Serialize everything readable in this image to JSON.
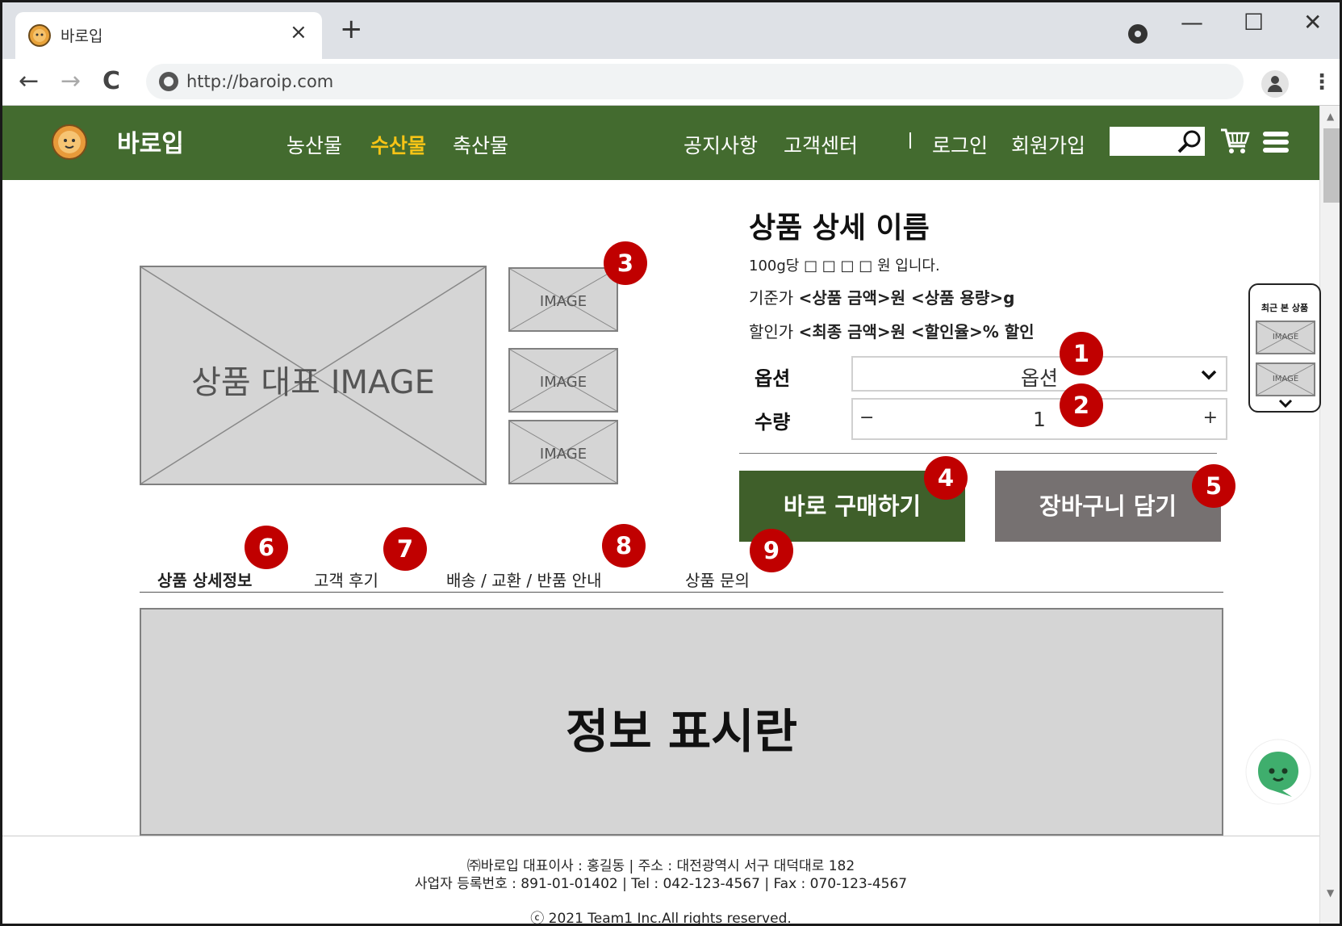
{
  "browser": {
    "tab_title": "바로입",
    "tab_close": "×",
    "new_tab": "+",
    "minimize": "—",
    "maximize": "☐",
    "close": "✕",
    "back": "←",
    "forward": "→",
    "reload": "C",
    "url": "http://baroip.com",
    "menu": "⋮"
  },
  "header": {
    "brand": "바로입",
    "categories": [
      "농산물",
      "수산물",
      "축산물"
    ],
    "active_category": "수산물",
    "links": [
      "공지사항",
      "고객센터"
    ],
    "auth": [
      "로그인",
      "회원가입"
    ],
    "search_value": "",
    "accent_color": "#436b2f",
    "active_color": "#f7c416"
  },
  "product": {
    "title": "상품 상세 이름",
    "unit_price_line": "100g당 □ □ □ □ 원 입니다.",
    "base_price_prefix": "기준가 ",
    "base_price_value": "<상품 금액>원 <상품 용량>g",
    "sale_price_prefix": "할인가 ",
    "sale_price_value": "<최종 금액>원 <할인율>% 할인",
    "main_image_label": "상품 대표 IMAGE",
    "thumb_label": "IMAGE",
    "option_label": "옵션",
    "option_value": "옵션",
    "qty_label": "수량",
    "qty_minus": "−",
    "qty_value": "1",
    "qty_plus": "+",
    "buy_label": "바로 구매하기",
    "cart_label": "장바구니 담기"
  },
  "badges": [
    "1",
    "2",
    "3",
    "4",
    "5",
    "6",
    "7",
    "8",
    "9"
  ],
  "recent": {
    "title": "최근 본 상품",
    "thumb_label": "IMAGE"
  },
  "detail_tabs": [
    "상품 상세정보",
    "고객 후기",
    "배송 / 교환 / 반품 안내",
    "상품 문의"
  ],
  "info_box": "정보 표시란",
  "footer": {
    "line1": "㈜바로입 대표이사 : 홍길동 | 주소 : 대전광역시 서구 대덕대로 182",
    "line2": "사업자 등록번호 : 891-01-01402 | Tel : 042-123-4567 | Fax : 070-123-4567",
    "copyright": "ⓒ 2021 Team1 Inc.All rights reserved."
  }
}
